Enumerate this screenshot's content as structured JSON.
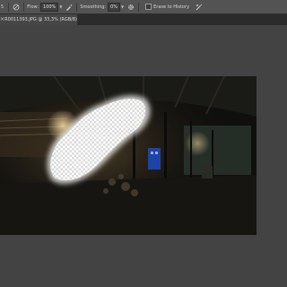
{
  "options_bar": {
    "tool_size_text": "5",
    "flow_label": "Flow:",
    "flow_value": "100%",
    "smoothing_label": "Smoothing:",
    "smoothing_value": "0%",
    "erase_to_history_label": "Erase to History"
  },
  "document": {
    "close_symbol": "×",
    "tab_title": "R0011393.JPG @ 33,3% (RGB/8)"
  },
  "icons": [
    "brush-preset-icon",
    "airbrush-icon",
    "gear-icon",
    "pressure-icon",
    "close-icon"
  ],
  "colors": {
    "options_bar_bg": "#535353",
    "canvas_bg": "#434343",
    "blue_door": "#1c44a8"
  }
}
